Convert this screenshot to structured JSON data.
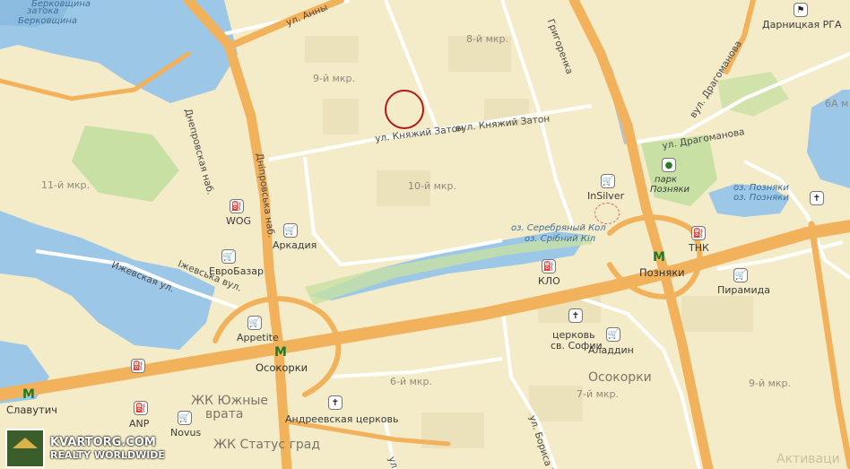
{
  "map": {
    "colors": {
      "land": "#f4ecc8",
      "water": "#9cc7e6",
      "park": "#c8e0a4",
      "highway": "#f2b25b",
      "road": "#ffffff",
      "rail": "#bfbfbf",
      "building": "#ebe2bb",
      "accent": "#b01a1a"
    },
    "water_labels": {
      "berkovshchina_ru": "Берковщина",
      "berkovshchina_bay": "затока",
      "berkovshchina_bay2": "Берковщина",
      "serebr_ru": "оз. Серебряный Кол",
      "serebr_ua": "оз. Срібний Кіл",
      "pozniaki_ru": "оз. Позняки",
      "pozniaki_ua": "оз. Позняки"
    },
    "district_labels": {
      "d8": "8-й мкр.",
      "d9": "9-й мкр.",
      "d10": "10-й мкр.",
      "d11": "11-й мкр.",
      "d6": "6-й мкр.",
      "d7": "7-й мкр.",
      "d9b": "9-й мкр.",
      "d6a": "6А м",
      "osokorki": "Осокорки",
      "zhk_yuzhnye": "ЖК Южные",
      "zhk_yuzhnye2": "врата",
      "zhk_status": "ЖК Статус град",
      "park": "парк",
      "park2": "Позняки"
    },
    "street_labels": {
      "anny": "ул. Анны",
      "dnipro_ru": "Днепровская наб.",
      "dnipro_ua": "Дніпровська наб.",
      "kniazhiy_ru": "ул. Княжий Затон",
      "kniazhiy_ua": "вул. Княжий Затон",
      "grigorenka": "Григоренка",
      "dragomanova_ru": "ул. Драгоманова",
      "dragomanova_ua": "вул. Драгоманова",
      "izhevskaya_ru": "Ижевская ул.",
      "izhevskaya_ua": "Іжевська вул.",
      "borysa": "ул. Бориса Гм",
      "ul": "ул"
    },
    "poi": {
      "darnitska": "Дарницкая РГА",
      "insilver": "InSilver",
      "wog": "WOG",
      "arkadia": "Аркадия",
      "evrobazar": "ЕвроБазар",
      "klo": "КЛО",
      "tnk": "ТНК",
      "piramida": "Пирамида",
      "appetite": "Appetite",
      "church_sofii": "церковь",
      "church_sofii2": "св. Софии",
      "aladdin": "Аладдин",
      "andreevskaya": "Андреевская церковь",
      "anp": "ANP",
      "novus": "Novus"
    },
    "metro": {
      "pozniaki": "Позняки",
      "osokorki": "Осокорки",
      "slavutich": "Славутич",
      "symbol": "M"
    },
    "watermark": {
      "main": "KVARTORG.COM",
      "sub": "REALTY WORLDWIDE",
      "bottom": "Активаци"
    }
  }
}
